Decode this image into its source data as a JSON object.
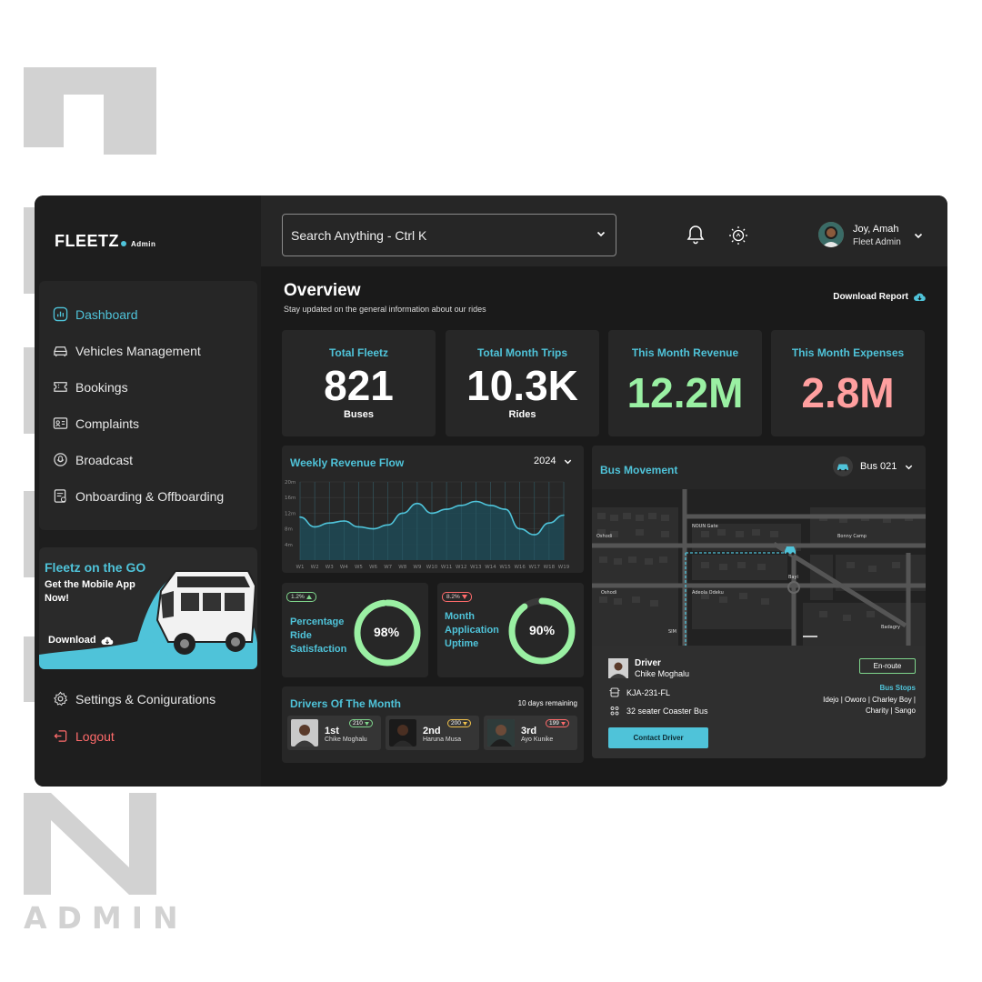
{
  "brand": {
    "name": "FLEETZ",
    "suffix": "Admin"
  },
  "sidebar": {
    "items": [
      {
        "label": "Dashboard",
        "icon": "dashboard-icon",
        "active": true
      },
      {
        "label": "Vehicles Management",
        "icon": "car-icon"
      },
      {
        "label": "Bookings",
        "icon": "ticket-icon"
      },
      {
        "label": "Complaints",
        "icon": "id-card-icon"
      },
      {
        "label": "Broadcast",
        "icon": "broadcast-icon"
      },
      {
        "label": "Onboarding & Offboarding",
        "icon": "clipboard-icon"
      }
    ],
    "promo": {
      "title": "Fleetz on the GO",
      "subtitle": "Get the Mobile App Now!",
      "download": "Download"
    },
    "settings": "Settings & Conigurations",
    "logout": "Logout"
  },
  "topbar": {
    "search_placeholder": "Search Anything - Ctrl K",
    "user": {
      "name": "Joy, Amah",
      "role": "Fleet Admin"
    }
  },
  "overview": {
    "title": "Overview",
    "subtitle": "Stay updated on the general information about our rides",
    "download_report": "Download Report"
  },
  "stats": [
    {
      "label": "Total Fleetz",
      "value": "821",
      "unit": "Buses",
      "color": "#ffffff"
    },
    {
      "label": "Total Month Trips",
      "value": "10.3K",
      "unit": "Rides",
      "color": "#ffffff"
    },
    {
      "label": "This Month Revenue",
      "value": "12.2M",
      "unit": "",
      "color": "#9af0a3"
    },
    {
      "label": "This Month Expenses",
      "value": "2.8M",
      "unit": "",
      "color": "#ff9f9f"
    }
  ],
  "revenue": {
    "title": "Weekly Revenue Flow",
    "year": "2024"
  },
  "chart_data": {
    "type": "area",
    "title": "Weekly Revenue Flow",
    "x": [
      "W1",
      "W2",
      "W3",
      "W4",
      "W5",
      "W6",
      "W7",
      "W8",
      "W9",
      "W10",
      "W11",
      "W12",
      "W13",
      "W14",
      "W15",
      "W16",
      "W17",
      "W18",
      "W19"
    ],
    "yticks": [
      "20m",
      "16m",
      "12m",
      "8m",
      "4m"
    ],
    "ylim": [
      0,
      20
    ],
    "series": [
      {
        "values": [
          11,
          8.5,
          9.5,
          10,
          8.5,
          8,
          9,
          12,
          14.5,
          12,
          13,
          14,
          15,
          14,
          13,
          8,
          6.5,
          9.5,
          11.5
        ]
      }
    ],
    "grid": true
  },
  "kpis": [
    {
      "badge": "1.2%",
      "trend": "up",
      "label": "Percentage Ride Satisfaction",
      "value": "98%",
      "percent": 98
    },
    {
      "badge": "8.2%",
      "trend": "down",
      "label": "Month Application Uptime",
      "value": "90%",
      "percent": 90
    }
  ],
  "drivers": {
    "title": "Drivers Of The Month",
    "remaining": "10 days remaining",
    "list": [
      {
        "rank": "1st",
        "name": "Chike Moghalu",
        "score": "210",
        "trend": "up"
      },
      {
        "rank": "2nd",
        "name": "Haruna Musa",
        "score": "200",
        "trend": "up"
      },
      {
        "rank": "3rd",
        "name": "Ayo Kunike",
        "score": "199",
        "trend": "down"
      }
    ]
  },
  "bus": {
    "title": "Bus Movement",
    "selected": "Bus 021",
    "map_labels": [
      "NOUN Gate",
      "Oshodi",
      "Bonny Camp",
      "Bayi",
      "Oshodi",
      "Adeola Odeku",
      "SIM",
      "Badagry"
    ],
    "driver_label": "Driver",
    "driver_name": "Chike Moghalu",
    "status": "En-route",
    "plate": "KJA-231-FL",
    "vehicle": "32 seater Coaster Bus",
    "stops_title": "Bus Stops",
    "stops": "Idejo | Oworo | Charley Boy |",
    "stops2": "Charity |  Sango",
    "contact": "Contact Driver"
  },
  "deco": {
    "admin": "ADMIN"
  }
}
